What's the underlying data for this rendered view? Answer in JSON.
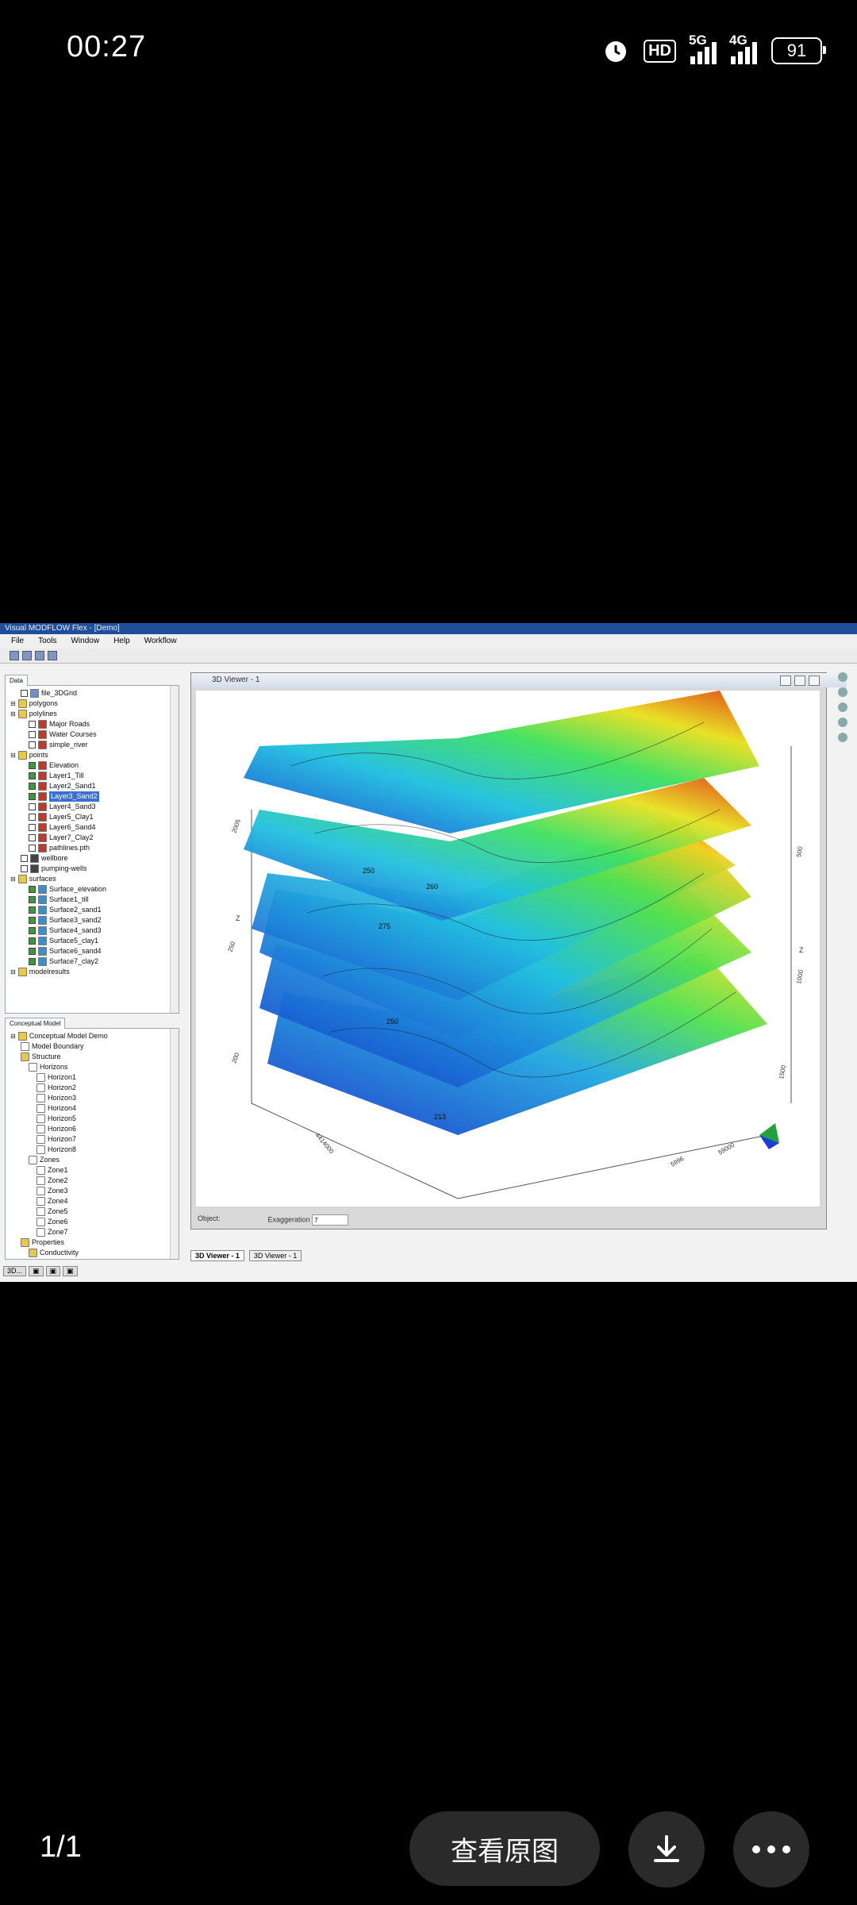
{
  "status": {
    "time": "00:27",
    "hd": "HD",
    "net1": "5G",
    "net2": "4G",
    "battery": "91"
  },
  "app": {
    "title": "Visual MODFLOW Flex - [Demo]",
    "menu": [
      "File",
      "Tools",
      "Window",
      "Help",
      "Workflow"
    ],
    "top_panel_tab": "Data",
    "top_tree": [
      {
        "label": "file_3DGrid",
        "indent": 1,
        "check": false,
        "color": "#6b8fd0"
      },
      {
        "label": "polygons",
        "indent": 0,
        "check": null,
        "color": "#e8c84a"
      },
      {
        "label": "polylines",
        "indent": 0,
        "check": null,
        "color": "#e8c84a"
      },
      {
        "label": "Major Roads",
        "indent": 2,
        "check": false,
        "color": "#c0392b"
      },
      {
        "label": "Water Courses",
        "indent": 2,
        "check": false,
        "color": "#c0392b"
      },
      {
        "label": "simple_river",
        "indent": 2,
        "check": false,
        "color": "#c0392b"
      },
      {
        "label": "points",
        "indent": 0,
        "check": null,
        "color": "#e8c84a"
      },
      {
        "label": "Elevation",
        "indent": 2,
        "check": true,
        "color": "#c0392b"
      },
      {
        "label": "Layer1_Till",
        "indent": 2,
        "check": true,
        "color": "#c0392b"
      },
      {
        "label": "Layer2_Sand1",
        "indent": 2,
        "check": true,
        "color": "#c0392b"
      },
      {
        "label": "Layer3_Sand2",
        "indent": 2,
        "check": true,
        "color": "#c0392b",
        "selected": true
      },
      {
        "label": "Layer4_Sand3",
        "indent": 2,
        "check": false,
        "color": "#c0392b"
      },
      {
        "label": "Layer5_Clay1",
        "indent": 2,
        "check": false,
        "color": "#c0392b"
      },
      {
        "label": "Layer6_Sand4",
        "indent": 2,
        "check": false,
        "color": "#c0392b"
      },
      {
        "label": "Layer7_Clay2",
        "indent": 2,
        "check": false,
        "color": "#c0392b"
      },
      {
        "label": "pathlines.pth",
        "indent": 2,
        "check": false,
        "color": "#c0392b"
      },
      {
        "label": "wellbore",
        "indent": 1,
        "check": false,
        "color": "#444"
      },
      {
        "label": "pumping-wells",
        "indent": 1,
        "check": false,
        "color": "#444"
      },
      {
        "label": "surfaces",
        "indent": 0,
        "check": null,
        "color": "#e8c84a"
      },
      {
        "label": "Surface_elevation",
        "indent": 2,
        "check": true,
        "color": "#3a8fd0"
      },
      {
        "label": "Surface1_till",
        "indent": 2,
        "check": true,
        "color": "#3a8fd0"
      },
      {
        "label": "Surface2_sand1",
        "indent": 2,
        "check": true,
        "color": "#3a8fd0"
      },
      {
        "label": "Surface3_sand2",
        "indent": 2,
        "check": true,
        "color": "#3a8fd0"
      },
      {
        "label": "Surface4_sand3",
        "indent": 2,
        "check": true,
        "color": "#3a8fd0"
      },
      {
        "label": "Surface5_clay1",
        "indent": 2,
        "check": true,
        "color": "#3a8fd0"
      },
      {
        "label": "Surface6_sand4",
        "indent": 2,
        "check": true,
        "color": "#3a8fd0"
      },
      {
        "label": "Surface7_clay2",
        "indent": 2,
        "check": true,
        "color": "#3a8fd0"
      },
      {
        "label": "modelresults",
        "indent": 0,
        "check": null,
        "color": "#e8c84a"
      }
    ],
    "bottom_panel_tab": "Conceptual Model",
    "bottom_tree": [
      {
        "label": "Conceptual Model Demo",
        "indent": 0,
        "color": "#e8c84a"
      },
      {
        "label": "Model Boundary",
        "indent": 1,
        "color": "#fff"
      },
      {
        "label": "Structure",
        "indent": 1,
        "color": "#e8c84a"
      },
      {
        "label": "Horizons",
        "indent": 2,
        "color": "#fff"
      },
      {
        "label": "Horizon1",
        "indent": 3,
        "color": "#fff"
      },
      {
        "label": "Horizon2",
        "indent": 3,
        "color": "#fff"
      },
      {
        "label": "Horizon3",
        "indent": 3,
        "color": "#fff"
      },
      {
        "label": "Horizon4",
        "indent": 3,
        "color": "#fff"
      },
      {
        "label": "Horizon5",
        "indent": 3,
        "color": "#fff"
      },
      {
        "label": "Horizon6",
        "indent": 3,
        "color": "#fff"
      },
      {
        "label": "Horizon7",
        "indent": 3,
        "color": "#fff"
      },
      {
        "label": "Horizon8",
        "indent": 3,
        "color": "#fff"
      },
      {
        "label": "Zones",
        "indent": 2,
        "color": "#fff"
      },
      {
        "label": "Zone1",
        "indent": 3,
        "color": "#fff"
      },
      {
        "label": "Zone2",
        "indent": 3,
        "color": "#fff"
      },
      {
        "label": "Zone3",
        "indent": 3,
        "color": "#fff"
      },
      {
        "label": "Zone4",
        "indent": 3,
        "color": "#fff"
      },
      {
        "label": "Zone5",
        "indent": 3,
        "color": "#fff"
      },
      {
        "label": "Zone6",
        "indent": 3,
        "color": "#fff"
      },
      {
        "label": "Zone7",
        "indent": 3,
        "color": "#fff"
      },
      {
        "label": "Properties",
        "indent": 1,
        "color": "#e8c84a"
      },
      {
        "label": "Conductivity",
        "indent": 2,
        "color": "#e8c84a"
      }
    ],
    "left_bottom_tab": "3D...",
    "viewer": {
      "title": "3D Viewer - 1",
      "footer_object": "Object:",
      "footer_exag": "Exaggeration",
      "exag_value": "7",
      "axis_z1": "Z",
      "axis_z2": "Z",
      "tick_left": [
        "2005",
        "250",
        "200"
      ],
      "tick_right": [
        "500",
        "1000",
        "1500"
      ],
      "tick_bottom": [
        "5996",
        "59000",
        "4414000"
      ],
      "contour_labels": [
        "260",
        "250",
        "275",
        "213",
        "250"
      ],
      "accent_high": "#e04010",
      "accent_low": "#1a3fd0"
    },
    "bottom_tabs": [
      "3D Viewer - 1",
      "3D Viewer - 1"
    ]
  },
  "bottom_bar": {
    "pager": "1/1",
    "view_original": "查看原图",
    "download_icon": "download-icon",
    "more_icon": "more-icon"
  }
}
